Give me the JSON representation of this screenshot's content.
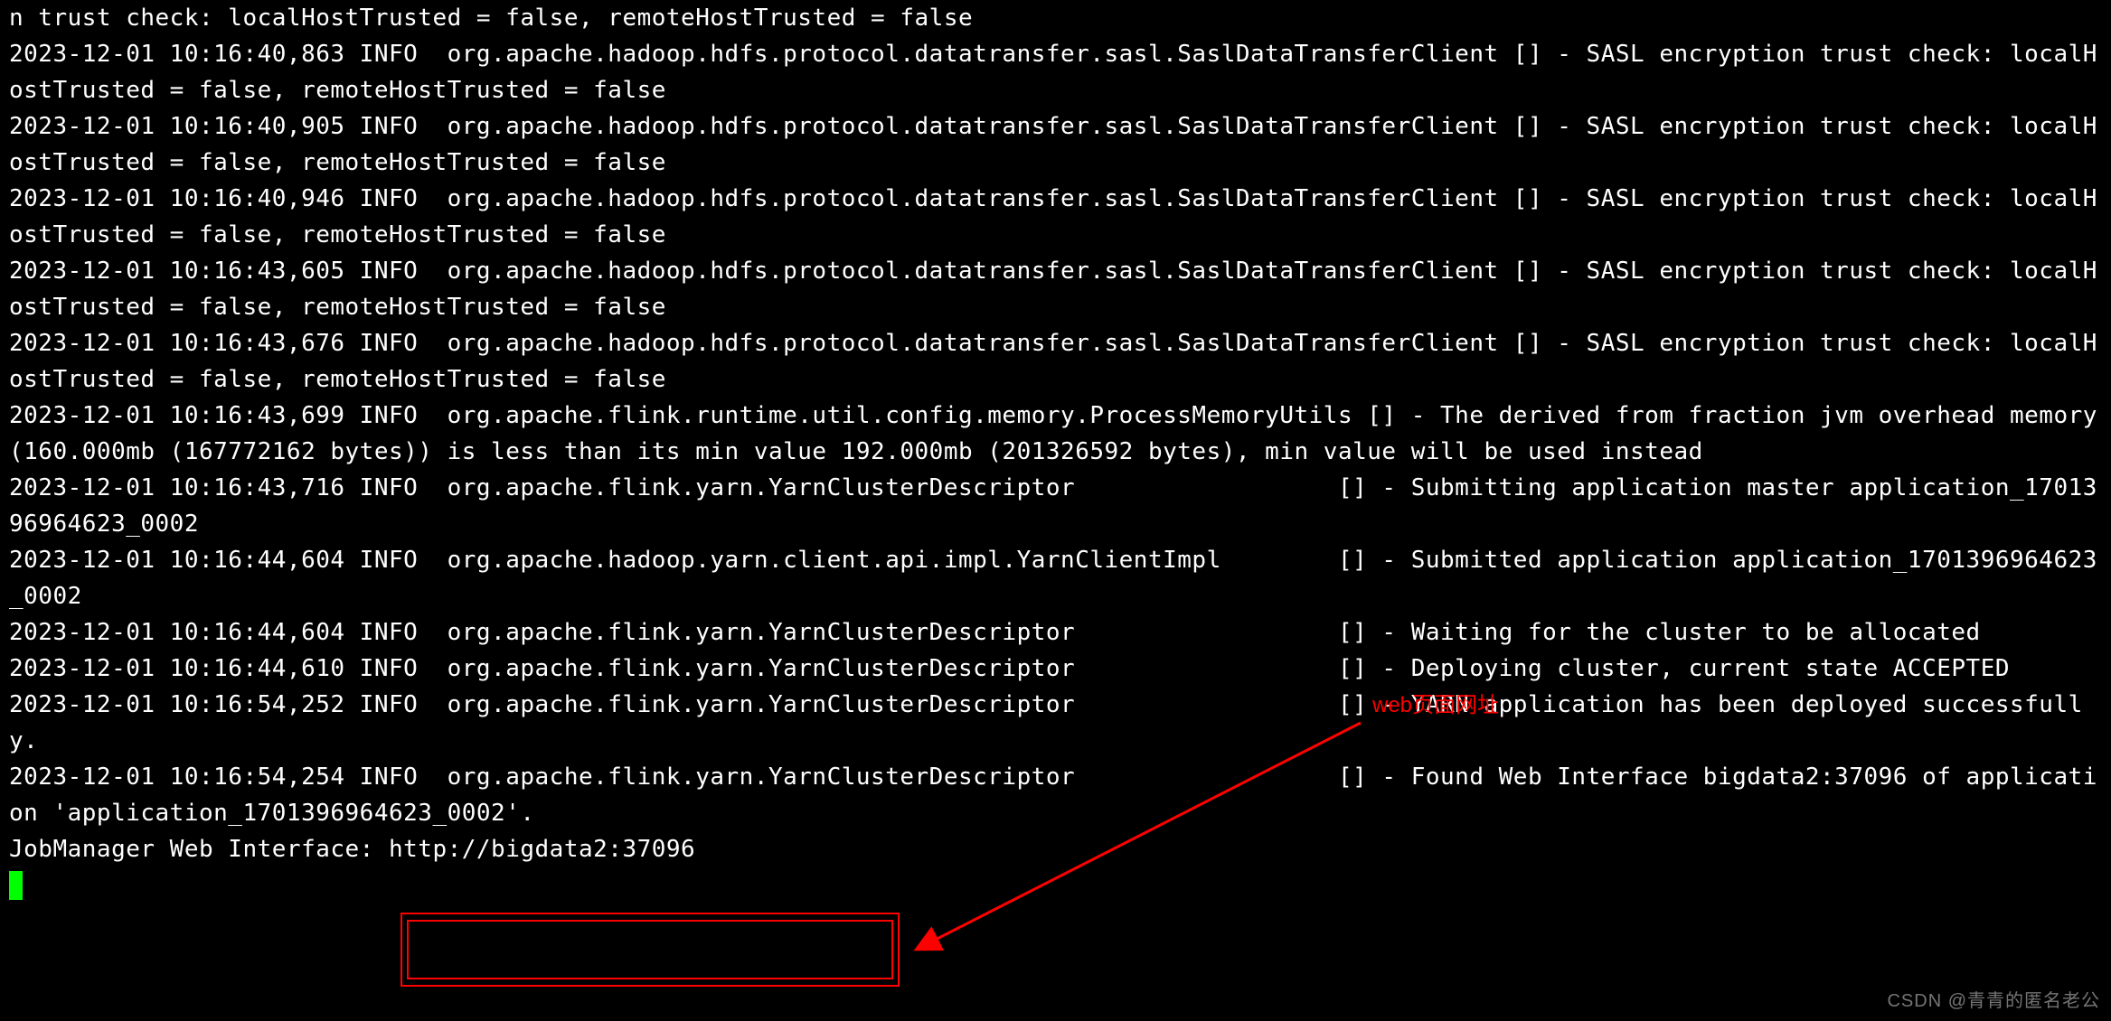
{
  "log_lines": [
    "n trust check: localHostTrusted = false, remoteHostTrusted = false",
    "2023-12-01 10:16:40,863 INFO  org.apache.hadoop.hdfs.protocol.datatransfer.sasl.SaslDataTransferClient [] - SASL encryption trust check: localHostTrusted = false, remoteHostTrusted = false",
    "2023-12-01 10:16:40,905 INFO  org.apache.hadoop.hdfs.protocol.datatransfer.sasl.SaslDataTransferClient [] - SASL encryption trust check: localHostTrusted = false, remoteHostTrusted = false",
    "2023-12-01 10:16:40,946 INFO  org.apache.hadoop.hdfs.protocol.datatransfer.sasl.SaslDataTransferClient [] - SASL encryption trust check: localHostTrusted = false, remoteHostTrusted = false",
    "2023-12-01 10:16:43,605 INFO  org.apache.hadoop.hdfs.protocol.datatransfer.sasl.SaslDataTransferClient [] - SASL encryption trust check: localHostTrusted = false, remoteHostTrusted = false",
    "2023-12-01 10:16:43,676 INFO  org.apache.hadoop.hdfs.protocol.datatransfer.sasl.SaslDataTransferClient [] - SASL encryption trust check: localHostTrusted = false, remoteHostTrusted = false",
    "2023-12-01 10:16:43,699 INFO  org.apache.flink.runtime.util.config.memory.ProcessMemoryUtils [] - The derived from fraction jvm overhead memory (160.000mb (167772162 bytes)) is less than its min value 192.000mb (201326592 bytes), min value will be used instead",
    "2023-12-01 10:16:43,716 INFO  org.apache.flink.yarn.YarnClusterDescriptor                  [] - Submitting application master application_1701396964623_0002",
    "2023-12-01 10:16:44,604 INFO  org.apache.hadoop.yarn.client.api.impl.YarnClientImpl        [] - Submitted application application_1701396964623_0002",
    "2023-12-01 10:16:44,604 INFO  org.apache.flink.yarn.YarnClusterDescriptor                  [] - Waiting for the cluster to be allocated",
    "2023-12-01 10:16:44,610 INFO  org.apache.flink.yarn.YarnClusterDescriptor                  [] - Deploying cluster, current state ACCEPTED",
    "2023-12-01 10:16:54,252 INFO  org.apache.flink.yarn.YarnClusterDescriptor                  [] - YARN application has been deployed successfully.",
    "2023-12-01 10:16:54,254 INFO  org.apache.flink.yarn.YarnClusterDescriptor                  [] - Found Web Interface bigdata2:37096 of application 'application_1701396964623_0002'.",
    "JobManager Web Interface: http://bigdata2:37096"
  ],
  "annotation_text": "web页面网址",
  "watermark_text": "CSDN @青青的匿名老公"
}
